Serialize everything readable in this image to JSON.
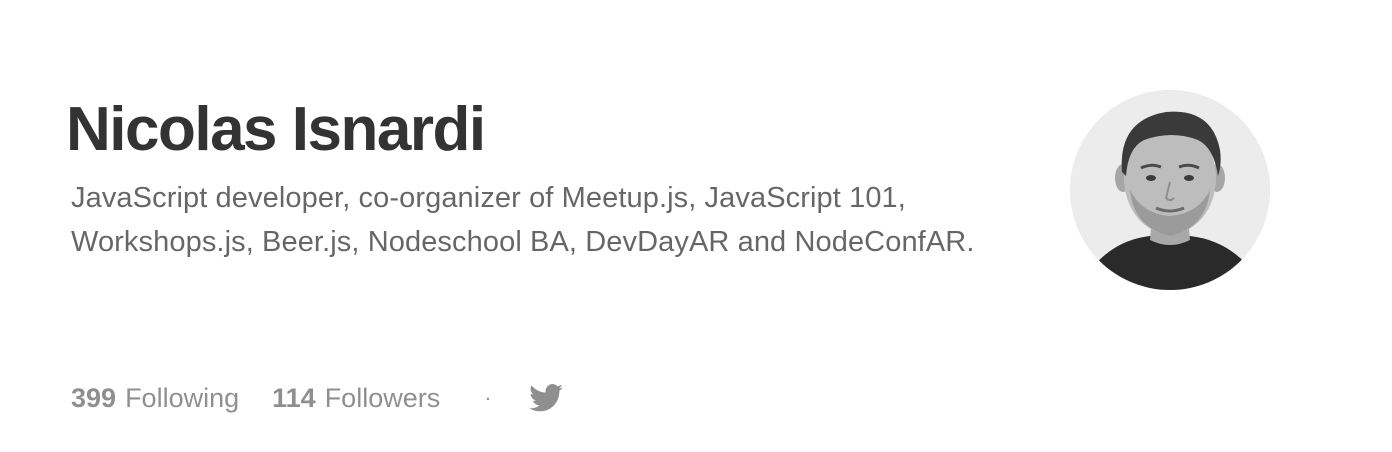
{
  "profile": {
    "name": "Nicolas Isnardi",
    "bio": "JavaScript developer, co-organizer of Meetup.js, JavaScript 101, Workshops.js, Beer.js, Nodeschool BA, DevDayAR and NodeConfAR.",
    "avatar_icon": "user-avatar-photo"
  },
  "stats": {
    "following_count": "399",
    "following_label": "Following",
    "followers_count": "114",
    "followers_label": "Followers",
    "separator": "·"
  },
  "social": {
    "twitter_icon": "twitter-bird-icon"
  },
  "colors": {
    "text_strong": "#333333",
    "text_muted": "#707070",
    "stat_gray": "#8f8f8f",
    "background": "#ffffff"
  }
}
